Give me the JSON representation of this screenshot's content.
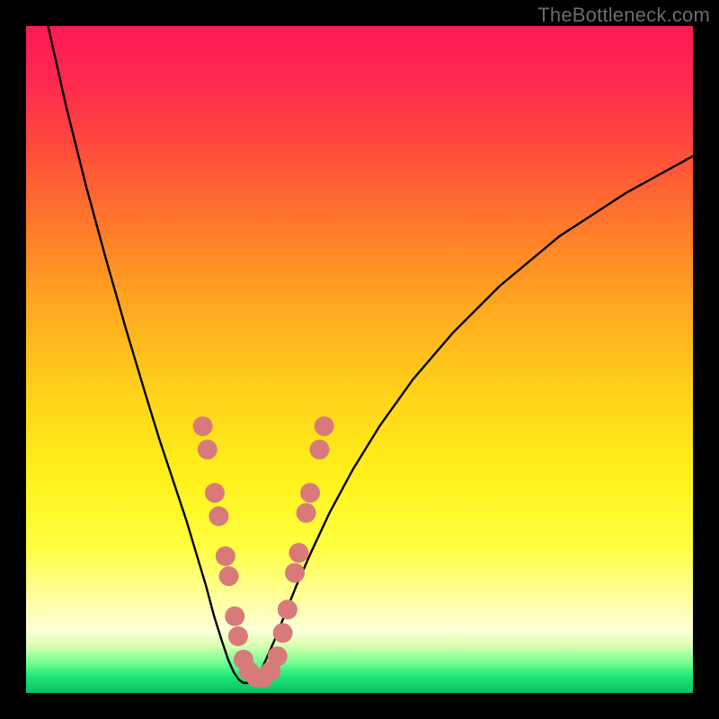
{
  "watermark": "TheBottleneck.com",
  "colors": {
    "frame": "#000000",
    "gradient_stops": [
      {
        "offset": 0.0,
        "color": "#ff1a55"
      },
      {
        "offset": 0.08,
        "color": "#ff2850"
      },
      {
        "offset": 0.18,
        "color": "#ff4a3c"
      },
      {
        "offset": 0.3,
        "color": "#ff7a2a"
      },
      {
        "offset": 0.42,
        "color": "#ffa820"
      },
      {
        "offset": 0.55,
        "color": "#ffd21a"
      },
      {
        "offset": 0.68,
        "color": "#fff21a"
      },
      {
        "offset": 0.78,
        "color": "#ffff40"
      },
      {
        "offset": 0.86,
        "color": "#ffffa0"
      },
      {
        "offset": 0.905,
        "color": "#ffffd8"
      },
      {
        "offset": 0.93,
        "color": "#d8ffb0"
      },
      {
        "offset": 0.955,
        "color": "#70ff90"
      },
      {
        "offset": 0.975,
        "color": "#20e876"
      },
      {
        "offset": 1.0,
        "color": "#08c060"
      }
    ],
    "curve": "#000000",
    "marker_fill": "#d97a7a",
    "marker_stroke": "#c96868"
  },
  "chart_data": {
    "type": "line",
    "title": "",
    "xlabel": "",
    "ylabel": "",
    "xlim": [
      0,
      100
    ],
    "ylim": [
      0,
      100
    ],
    "series": [
      {
        "name": "left-curve",
        "x": [
          3.3,
          6,
          9,
          12,
          15,
          18,
          20,
          22,
          24,
          25.5,
          27,
          28.2,
          29.3,
          30.3,
          31.2,
          31.9
        ],
        "y": [
          100,
          88,
          76,
          65,
          54.5,
          44.5,
          38,
          32,
          26,
          21,
          16,
          11.5,
          8,
          5,
          3,
          2
        ]
      },
      {
        "name": "right-curve",
        "x": [
          34.5,
          35.3,
          36.2,
          37.3,
          38.7,
          40.5,
          42.7,
          45.5,
          49,
          53,
          58,
          64,
          71,
          80,
          90,
          100
        ],
        "y": [
          2,
          3.5,
          5.5,
          8,
          11.5,
          16,
          21,
          27,
          33.5,
          40,
          47,
          54,
          61,
          68.5,
          75,
          80.5
        ]
      },
      {
        "name": "bottom-connector",
        "x": [
          31.9,
          32.6,
          33.5,
          34.5
        ],
        "y": [
          2,
          1.5,
          1.5,
          2
        ]
      }
    ],
    "markers": [
      {
        "x": 26.5,
        "y": 40.0
      },
      {
        "x": 27.2,
        "y": 36.5
      },
      {
        "x": 28.3,
        "y": 30.0
      },
      {
        "x": 28.9,
        "y": 26.5
      },
      {
        "x": 29.9,
        "y": 20.5
      },
      {
        "x": 30.4,
        "y": 17.5
      },
      {
        "x": 31.3,
        "y": 11.5
      },
      {
        "x": 31.8,
        "y": 8.5
      },
      {
        "x": 32.6,
        "y": 5.0
      },
      {
        "x": 33.4,
        "y": 3.3
      },
      {
        "x": 34.5,
        "y": 2.3
      },
      {
        "x": 35.6,
        "y": 2.3
      },
      {
        "x": 36.7,
        "y": 3.3
      },
      {
        "x": 37.7,
        "y": 5.5
      },
      {
        "x": 38.5,
        "y": 9.0
      },
      {
        "x": 39.2,
        "y": 12.5
      },
      {
        "x": 40.3,
        "y": 18.0
      },
      {
        "x": 40.9,
        "y": 21.0
      },
      {
        "x": 42.0,
        "y": 27.0
      },
      {
        "x": 42.6,
        "y": 30.0
      },
      {
        "x": 44.0,
        "y": 36.5
      },
      {
        "x": 44.7,
        "y": 40.0
      }
    ],
    "marker_radius_px": 11
  }
}
